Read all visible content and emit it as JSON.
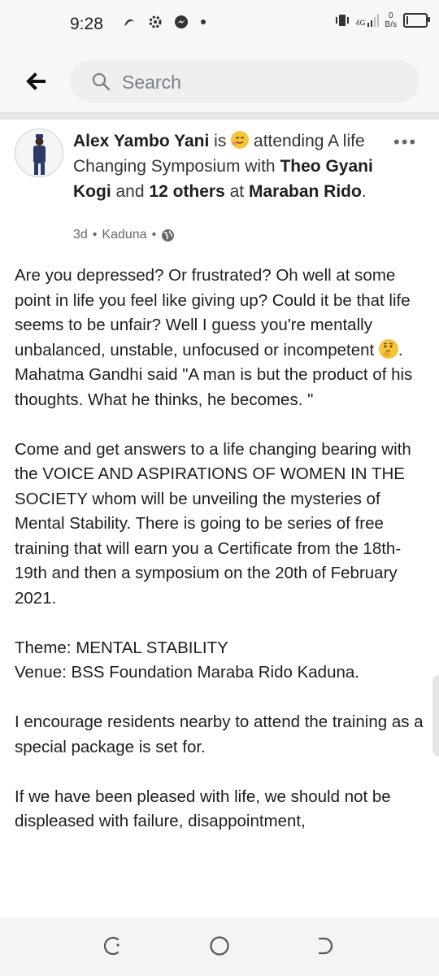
{
  "status_bar": {
    "time": "9:28",
    "network_type": "4G",
    "speed_value": "0",
    "speed_unit": "B/s"
  },
  "search": {
    "placeholder": "Search"
  },
  "post": {
    "author": "Alex Yambo Yani",
    "verb_is": "is",
    "activity": "attending A life Changing Symposium with",
    "with_person": "Theo Gyani Kogi",
    "and_word": "and",
    "others": "12 others",
    "at_word": "at",
    "place": "Maraban Rido",
    "period": ".",
    "time_ago": "3d",
    "location": "Kaduna",
    "separator": "•",
    "more_label": "•••",
    "body_1": "Are you depressed? Or frustrated? Oh well at some point in life you feel like giving up? Could it be that life seems to be unfair? Well I guess you're mentally unbalanced, unstable, unfocused or incompetent",
    "body_1_end": ".",
    "body_2": "Mahatma Gandhi said \"A man is but the product of his thoughts. What he thinks, he becomes. \"\n\nCome and get answers to a life changing bearing with the VOICE AND ASPIRATIONS OF WOMEN IN THE SOCIETY whom will be unveiling the mysteries of Mental Stability. There is going to be series of free training that will earn you a Certificate from the 18th-19th and then a symposium on the 20th of February 2021.\n\nTheme: MENTAL STABILITY\nVenue: BSS Foundation Maraba Rido Kaduna.\n\nI encourage residents nearby to attend the training as a special package is set for.\n\nIf we have been pleased with life, we should not be displeased with failure, disappointment,"
  },
  "icons": {
    "back": "arrow-left-icon",
    "search": "magnifier-icon",
    "globe": "globe-icon"
  },
  "colors": {
    "text": "#1c1e21",
    "muted": "#65676b",
    "search_bg": "#eeeff1"
  }
}
